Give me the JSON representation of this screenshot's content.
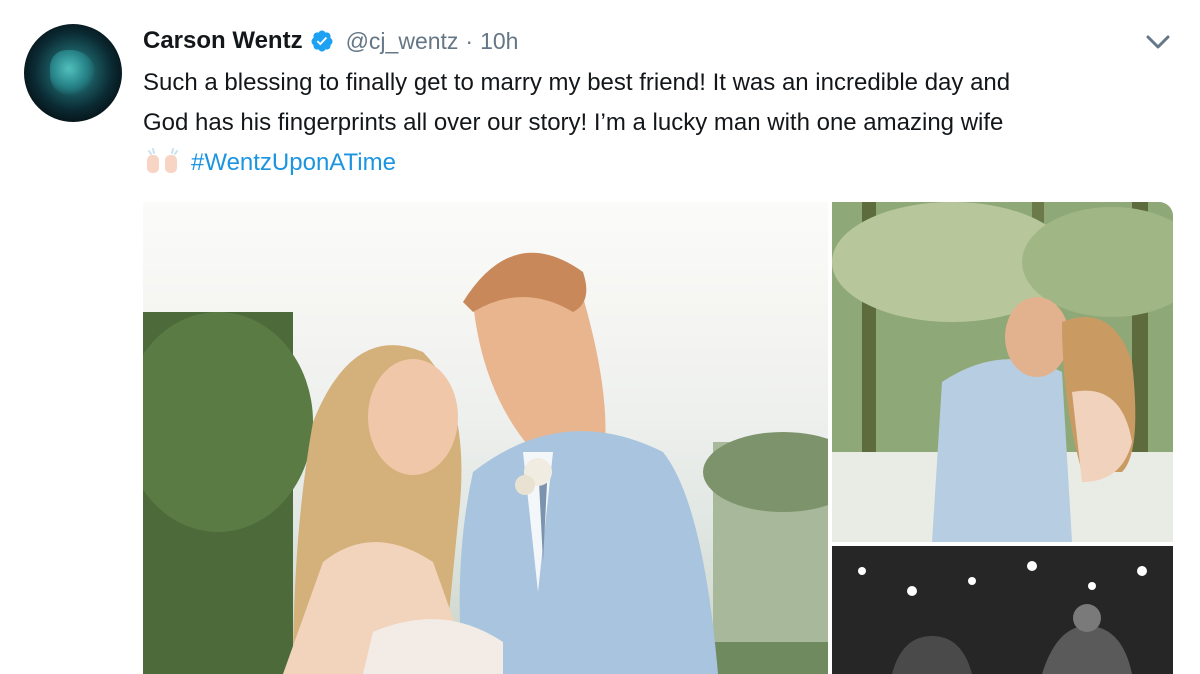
{
  "tweet": {
    "author_name": "Carson Wentz",
    "handle": "@cj_wentz",
    "separator": "·",
    "time": "10h",
    "text_lines": [
      "Such a blessing to finally get to marry my best friend! It was an incredible day and",
      "God has his fingerprints all over our story! I’m a lucky man with one amazing wife"
    ],
    "hashtag": "#WentzUponATime"
  },
  "icons": {
    "verified": "verified-badge-icon",
    "caret": "chevron-down-icon",
    "emoji": "raising-hands-emoji"
  },
  "colors": {
    "name": "#14171a",
    "muted": "#657786",
    "link": "#1b95e0",
    "verified": "#1da1f2"
  },
  "media": {
    "count": 3
  }
}
